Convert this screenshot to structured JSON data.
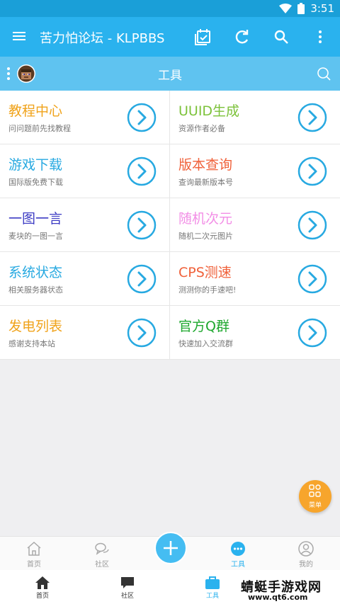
{
  "status": {
    "time": "3:51"
  },
  "appbar": {
    "title": "苦力怕论坛 - KLPBBS"
  },
  "subbar": {
    "title": "工具"
  },
  "tools": [
    {
      "title": "教程中心",
      "subtitle": "问问题前先找教程",
      "color": "#f0a31b"
    },
    {
      "title": "UUID生成",
      "subtitle": "资源作者必备",
      "color": "#7cc23a"
    },
    {
      "title": "游戏下载",
      "subtitle": "国际版免费下载",
      "color": "#27a9e1"
    },
    {
      "title": "版本查询",
      "subtitle": "查询最新版本号",
      "color": "#f0613a"
    },
    {
      "title": "一图一言",
      "subtitle": "麦块的一图一言",
      "color": "#3d3cc4"
    },
    {
      "title": "随机次元",
      "subtitle": "随机二次元图片",
      "color": "#f28ee6"
    },
    {
      "title": "系统状态",
      "subtitle": "相关服务器状态",
      "color": "#27a9e1"
    },
    {
      "title": "CPS测速",
      "subtitle": "测测你的手速吧!",
      "color": "#f0613a"
    },
    {
      "title": "发电列表",
      "subtitle": "感谢支持本站",
      "color": "#f0a31b"
    },
    {
      "title": "官方Q群",
      "subtitle": "快速加入交流群",
      "color": "#1fa82f"
    }
  ],
  "fab_menu": {
    "label": "菜单"
  },
  "bottom_nav": [
    {
      "label": "首页"
    },
    {
      "label": "社区"
    },
    {
      "label": "工具"
    },
    {
      "label": "我的"
    }
  ],
  "bottom_nav2": [
    {
      "label": "首页"
    },
    {
      "label": "社区"
    },
    {
      "label": "工具"
    }
  ],
  "watermark": {
    "line1": "蜻蜓手游戏网",
    "line2": "www.qt6.com"
  },
  "colors": {
    "accent": "#2ab2ee",
    "status_bar": "#1a9fd8",
    "subbar": "#5fc3f0",
    "fab": "#f7a52c"
  }
}
